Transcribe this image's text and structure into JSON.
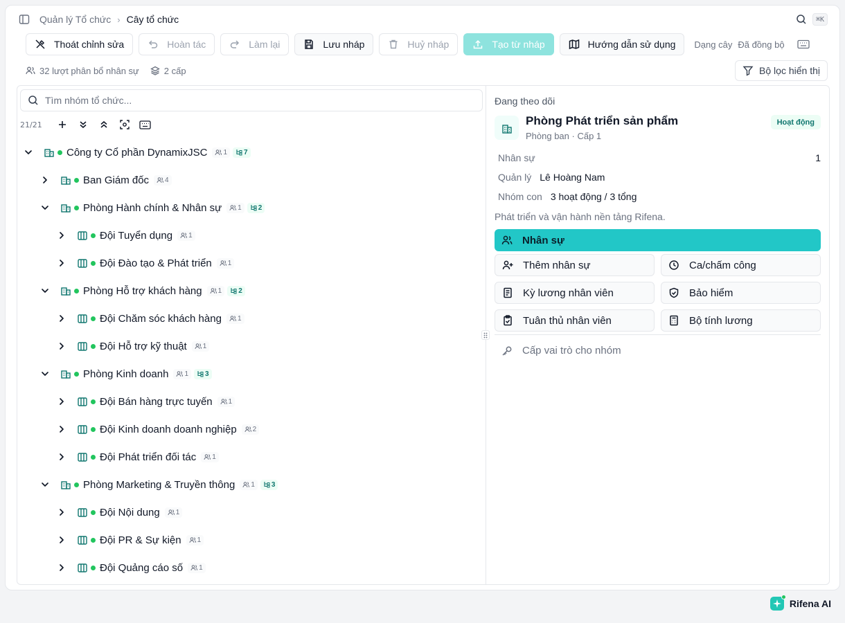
{
  "breadcrumb": {
    "root": "Quản lý Tổ chức",
    "current": "Cây tổ chức"
  },
  "topbar": {
    "shortcut": "⌘K"
  },
  "toolbar": {
    "exit_edit": "Thoát chỉnh sửa",
    "undo": "Hoàn tác",
    "redo": "Làm lại",
    "save_draft": "Lưu nháp",
    "cancel_draft": "Huỷ nháp",
    "create_from_draft": "Tạo từ nháp",
    "guide": "Hướng dẫn sử dụng",
    "view_mode": "Dạng cây",
    "sync_status": "Đã đồng bộ"
  },
  "stats": {
    "assignments": "32 lượt phân bổ nhân sự",
    "levels": "2 cấp",
    "filter": "Bộ lọc hiển thị"
  },
  "search": {
    "placeholder": "Tìm nhóm tổ chức..."
  },
  "tree_count": "21/21",
  "tree": [
    {
      "label": "Công ty Cổ phần DynamixJSC",
      "level": 0,
      "expanded": true,
      "members": "1",
      "children": "7",
      "icon": "building-icon"
    },
    {
      "label": "Ban Giám đốc",
      "level": 1,
      "expanded": false,
      "members": "4",
      "children": "",
      "icon": "building-icon"
    },
    {
      "label": "Phòng Hành chính & Nhân sự",
      "level": 1,
      "expanded": true,
      "members": "1",
      "children": "2",
      "icon": "building-icon"
    },
    {
      "label": "Đội Tuyển dụng",
      "level": 2,
      "expanded": false,
      "members": "1",
      "children": "",
      "icon": "team-icon"
    },
    {
      "label": "Đội Đào tạo & Phát triển",
      "level": 2,
      "expanded": false,
      "members": "1",
      "children": "",
      "icon": "team-icon"
    },
    {
      "label": "Phòng Hỗ trợ khách hàng",
      "level": 1,
      "expanded": true,
      "members": "1",
      "children": "2",
      "icon": "building-icon"
    },
    {
      "label": "Đội Chăm sóc khách hàng",
      "level": 2,
      "expanded": false,
      "members": "1",
      "children": "",
      "icon": "team-icon"
    },
    {
      "label": "Đội Hỗ trợ kỹ thuật",
      "level": 2,
      "expanded": false,
      "members": "1",
      "children": "",
      "icon": "team-icon"
    },
    {
      "label": "Phòng Kinh doanh",
      "level": 1,
      "expanded": true,
      "members": "1",
      "children": "3",
      "icon": "building-icon"
    },
    {
      "label": "Đội Bán hàng trực tuyến",
      "level": 2,
      "expanded": false,
      "members": "1",
      "children": "",
      "icon": "team-icon"
    },
    {
      "label": "Đội Kinh doanh doanh nghiệp",
      "level": 2,
      "expanded": false,
      "members": "2",
      "children": "",
      "icon": "team-icon"
    },
    {
      "label": "Đội Phát triển đối tác",
      "level": 2,
      "expanded": false,
      "members": "1",
      "children": "",
      "icon": "team-icon"
    },
    {
      "label": "Phòng Marketing & Truyền thông",
      "level": 1,
      "expanded": true,
      "members": "1",
      "children": "3",
      "icon": "building-icon"
    },
    {
      "label": "Đội Nội dung",
      "level": 2,
      "expanded": false,
      "members": "1",
      "children": "",
      "icon": "team-icon"
    },
    {
      "label": "Đội PR & Sự kiện",
      "level": 2,
      "expanded": false,
      "members": "1",
      "children": "",
      "icon": "team-icon"
    },
    {
      "label": "Đội Quảng cáo số",
      "level": 2,
      "expanded": false,
      "members": "1",
      "children": "",
      "icon": "team-icon"
    }
  ],
  "detail": {
    "tracking_label": "Đang theo dõi",
    "title": "Phòng Phát triển sản phẩm",
    "subtitle": "Phòng ban · Cấp 1",
    "status": "Hoạt động",
    "staff_label": "Nhân sự",
    "staff_value": "1",
    "manager_label": "Quản lý",
    "manager_value": "Lê Hoàng Nam",
    "subgroups_label": "Nhóm con",
    "subgroups_value": "3 hoạt động / 3 tổng",
    "description": "Phát triển và vận hành nền tảng Rifena.",
    "actions": {
      "staff": "Nhân sự",
      "add_staff": "Thêm nhân sự",
      "shift": "Ca/chấm công",
      "payroll": "Kỳ lương nhân viên",
      "insurance": "Bảo hiểm",
      "compliance": "Tuân thủ nhân viên",
      "salary_calc": "Bộ tính lương",
      "assign_role": "Cấp vai trò cho nhóm"
    }
  },
  "assistant": {
    "label": "Rifena AI"
  },
  "colors": {
    "accent": "#22c7c7",
    "accent_light": "#8ee3de",
    "active_dot": "#22c55e",
    "icon_teal": "#0f766e"
  }
}
